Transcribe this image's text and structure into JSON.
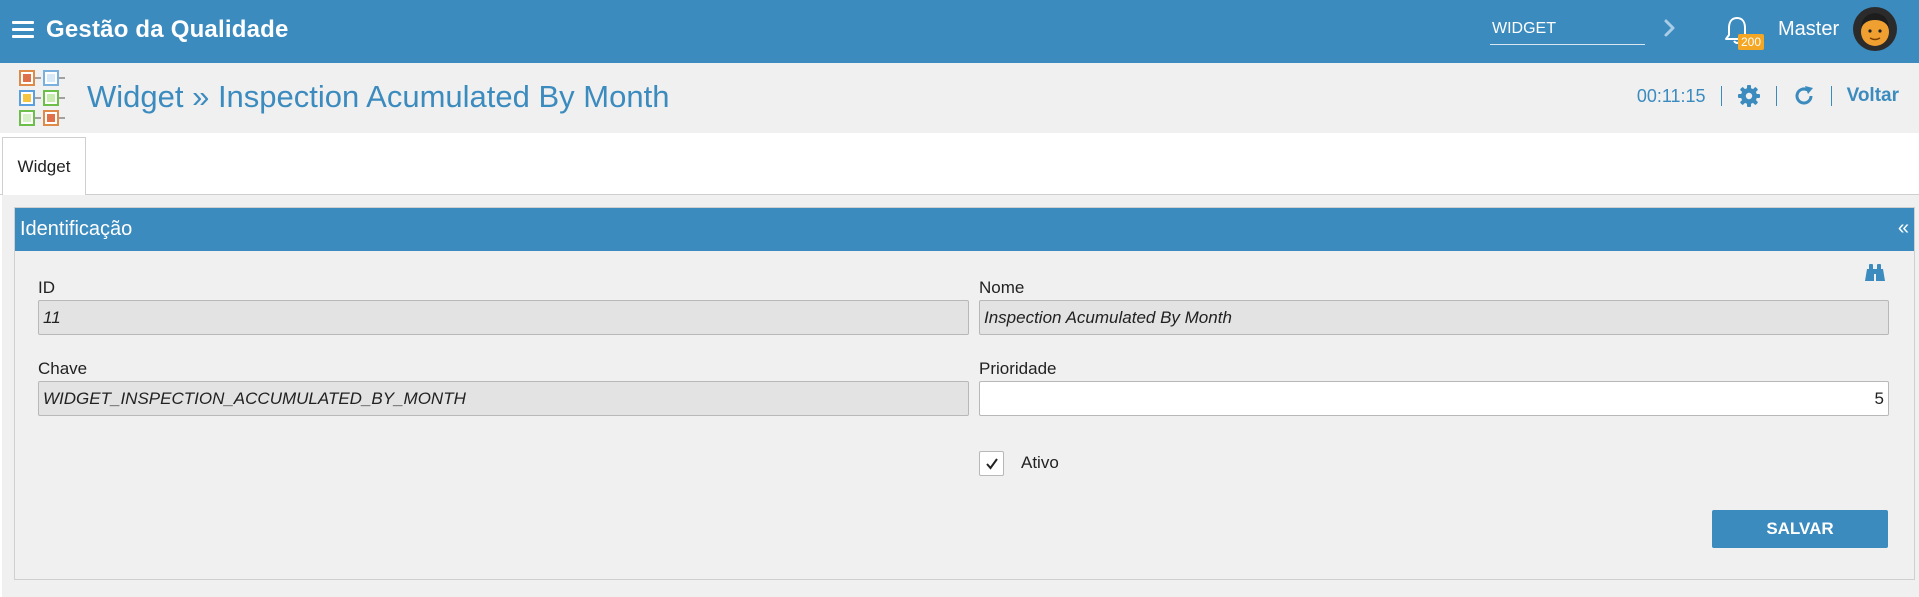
{
  "topbar": {
    "app_title": "Gestão da Qualidade",
    "search_value": "WIDGET",
    "notification_count": "200",
    "user_name": "Master"
  },
  "page_header": {
    "title": "Widget » Inspection Acumulated By Month",
    "timer": "00:11:15",
    "back_label": "Voltar"
  },
  "tabs": [
    {
      "label": "Widget",
      "active": true
    }
  ],
  "panel": {
    "title": "Identificação",
    "collapse_symbol": "«"
  },
  "form": {
    "id": {
      "label": "ID",
      "value": "11"
    },
    "nome": {
      "label": "Nome",
      "value": "Inspection Acumulated By Month"
    },
    "chave": {
      "label": "Chave",
      "value": "WIDGET_INSPECTION_ACCUMULATED_BY_MONTH"
    },
    "prioridade": {
      "label": "Prioridade",
      "value": "5"
    },
    "ativo": {
      "label": "Ativo",
      "checked": true
    }
  },
  "actions": {
    "save_label": "SALVAR"
  },
  "colors": {
    "primary": "#3b8bbf",
    "badge": "#f5a623",
    "background": "#f0f0f0",
    "readonly_input": "#e3e3e3"
  },
  "icons": {
    "menu": "hamburger-icon",
    "search_go": "chevron-right-icon",
    "notifications": "bell-icon",
    "settings": "gear-icon",
    "refresh": "refresh-icon",
    "search_record": "binoculars-icon",
    "checkbox": "checkmark-icon"
  }
}
